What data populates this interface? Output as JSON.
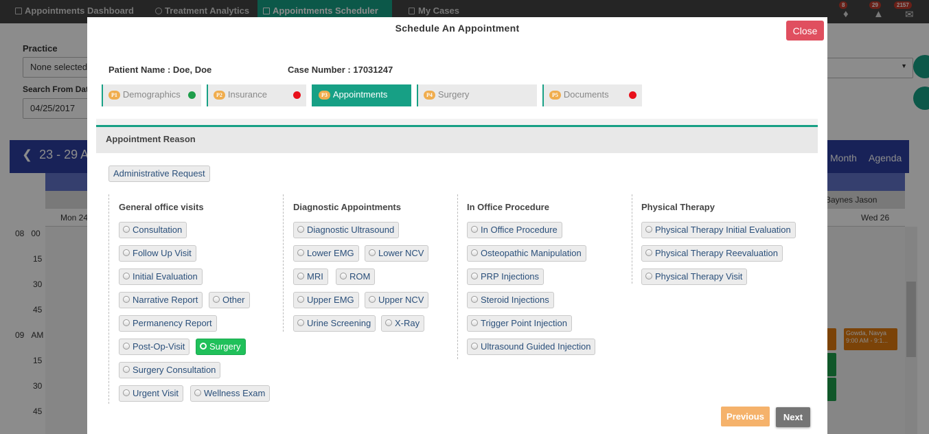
{
  "topnav": {
    "tabs": [
      {
        "label": "Appointments Dashboard"
      },
      {
        "label": "Treatment Analytics"
      },
      {
        "label": "Appointments Scheduler"
      },
      {
        "label": "My Cases"
      }
    ],
    "badges": {
      "tags": "8",
      "bell": "29",
      "mail": "2157"
    }
  },
  "background": {
    "practice_label": "Practice",
    "practice_value": "None selected",
    "search_from_label": "Search From Dat",
    "search_from_value": "04/25/2017",
    "calendar_range": "23 - 29 A",
    "views": {
      "month": "Month",
      "agenda": "Agenda"
    },
    "resource": "Baynes Jason",
    "days": {
      "mon": "Mon 24",
      "wed": "Wed 26"
    },
    "times": [
      {
        "h": "08",
        "m": "00"
      },
      {
        "h": "",
        "m": "15"
      },
      {
        "h": "",
        "m": "30"
      },
      {
        "h": "",
        "m": "45"
      },
      {
        "h": "09",
        "m": "AM"
      },
      {
        "h": "",
        "m": "15"
      },
      {
        "h": "",
        "m": "30"
      },
      {
        "h": "",
        "m": "45"
      }
    ],
    "event": {
      "name": "Gowda, Navya",
      "time": "9:00 AM - 9:1..."
    }
  },
  "modal": {
    "title": "Schedule An Appointment",
    "close_label": "Close",
    "patient_name": "Patient Name : Doe, Doe",
    "case_number": "Case Number : 17031247",
    "steps": [
      {
        "num": "P1",
        "label": "Demographics",
        "dot": "#1e9e4b"
      },
      {
        "num": "P2",
        "label": "Insurance",
        "dot": "#e8101b"
      },
      {
        "num": "P3",
        "label": "Appointments",
        "dot": ""
      },
      {
        "num": "P4",
        "label": "Surgery",
        "dot": ""
      },
      {
        "num": "P5",
        "label": "Documents",
        "dot": "#e8101b"
      }
    ],
    "reason_header": "Appointment Reason",
    "admin_request": "Administrative Request",
    "columns": [
      {
        "title": "General office visits",
        "options": [
          "Consultation",
          "Follow Up Visit",
          "Initial Evaluation",
          "Narrative Report",
          "Other",
          "Permanency Report",
          "Post-Op-Visit",
          "Surgery",
          "Surgery Consultation",
          "Urgent Visit",
          "Wellness Exam"
        ]
      },
      {
        "title": "Diagnostic Appointments",
        "options": [
          "Diagnostic Ultrasound",
          "Lower EMG",
          "Lower NCV",
          "MRI",
          "ROM",
          "Upper EMG",
          "Upper NCV",
          "Urine Screening",
          "X-Ray"
        ]
      },
      {
        "title": "In Office Procedure",
        "options": [
          "In Office Procedure",
          "Osteopathic Manipulation",
          "PRP Injections",
          "Steroid Injections",
          "Trigger Point Injection",
          "Ultrasound Guided Injection"
        ]
      },
      {
        "title": "Physical Therapy",
        "options": [
          "Physical Therapy Initial Evaluation",
          "Physical Therapy Reevaluation",
          "Physical Therapy Visit"
        ]
      }
    ],
    "selected_option": "Surgery",
    "previous_label": "Previous",
    "next_label": "Next"
  },
  "colors": {
    "accent": "#17a085",
    "selected_chip": "#20c05a",
    "close_button": "#e04f5f",
    "previous_button": "#f5b26b",
    "next_button": "#757575"
  }
}
